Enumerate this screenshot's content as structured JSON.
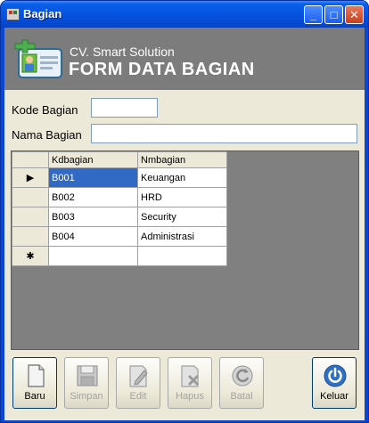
{
  "window": {
    "title": "Bagian",
    "minimize_label": "_",
    "maximize_label": "□",
    "close_label": "✕"
  },
  "header": {
    "company": "CV. Smart Solution",
    "form_title": "FORM DATA BAGIAN",
    "icon": "user-card-icon"
  },
  "form": {
    "kode_label": "Kode Bagian",
    "kode_value": "",
    "nama_label": "Nama Bagian",
    "nama_value": ""
  },
  "grid": {
    "columns": [
      "Kdbagian",
      "Nmbagian"
    ],
    "rows": [
      {
        "indicator": "▶",
        "kd": "B001",
        "nm": "Keuangan"
      },
      {
        "indicator": "",
        "kd": "B002",
        "nm": "HRD"
      },
      {
        "indicator": "",
        "kd": "B003",
        "nm": "Security"
      },
      {
        "indicator": "",
        "kd": "B004",
        "nm": "Administrasi"
      }
    ],
    "new_row_indicator": "✱",
    "selected_cell_color": "#316ac5"
  },
  "buttons": {
    "baru": "Baru",
    "simpan": "Simpan",
    "edit": "Edit",
    "hapus": "Hapus",
    "batal": "Batal",
    "keluar": "Keluar"
  },
  "colors": {
    "titlebar": "#0654e0",
    "header_bg": "#7c7c7c",
    "client_bg": "#ece9d8",
    "grid_bg": "#808080"
  }
}
